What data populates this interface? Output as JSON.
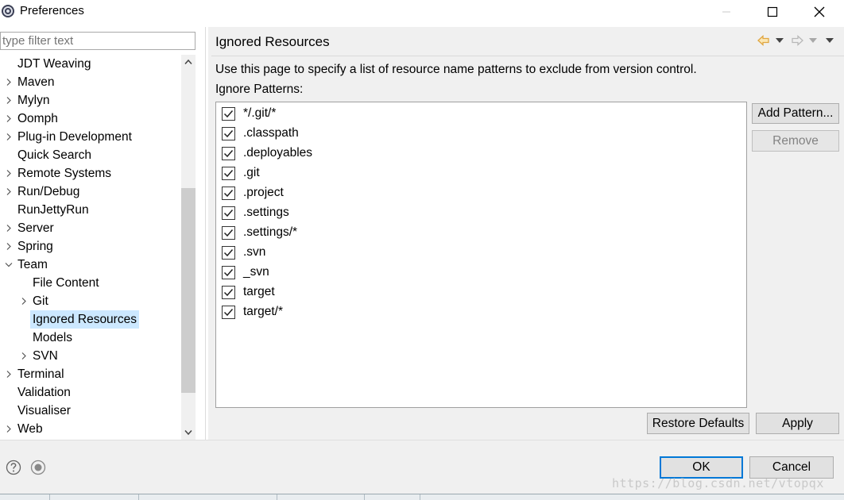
{
  "window": {
    "title": "Preferences"
  },
  "left": {
    "filter_placeholder": "type filter text",
    "tree": [
      {
        "label": "JDT Weaving",
        "twisty": ""
      },
      {
        "label": "Maven",
        "twisty": ">"
      },
      {
        "label": "Mylyn",
        "twisty": ">"
      },
      {
        "label": "Oomph",
        "twisty": ">"
      },
      {
        "label": "Plug-in Development",
        "twisty": ">"
      },
      {
        "label": "Quick Search",
        "twisty": ""
      },
      {
        "label": "Remote Systems",
        "twisty": ">"
      },
      {
        "label": "Run/Debug",
        "twisty": ">"
      },
      {
        "label": "RunJettyRun",
        "twisty": ""
      },
      {
        "label": "Server",
        "twisty": ">"
      },
      {
        "label": "Spring",
        "twisty": ">"
      },
      {
        "label": "Team",
        "twisty": "v"
      },
      {
        "label": "File Content",
        "twisty": "",
        "child": true
      },
      {
        "label": "Git",
        "twisty": ">",
        "child": true
      },
      {
        "label": "Ignored Resources",
        "twisty": "",
        "child": true,
        "selected": true
      },
      {
        "label": "Models",
        "twisty": "",
        "child": true
      },
      {
        "label": "SVN",
        "twisty": ">",
        "child": true
      },
      {
        "label": "Terminal",
        "twisty": ">"
      },
      {
        "label": "Validation",
        "twisty": ""
      },
      {
        "label": "Visualiser",
        "twisty": ""
      },
      {
        "label": "Web",
        "twisty": ">"
      }
    ]
  },
  "page": {
    "title": "Ignored Resources",
    "description": "Use this page to specify a list of resource name patterns to exclude from version control.",
    "patterns_label": "Ignore Patterns:",
    "patterns": [
      {
        "label": "*/.git/*",
        "checked": true
      },
      {
        "label": ".classpath",
        "checked": true
      },
      {
        "label": ".deployables",
        "checked": true
      },
      {
        "label": ".git",
        "checked": true
      },
      {
        "label": ".project",
        "checked": true
      },
      {
        "label": ".settings",
        "checked": true
      },
      {
        "label": ".settings/*",
        "checked": true
      },
      {
        "label": ".svn",
        "checked": true
      },
      {
        "label": "_svn",
        "checked": true
      },
      {
        "label": "target",
        "checked": true
      },
      {
        "label": "target/*",
        "checked": true
      }
    ],
    "add_pattern_label": "Add Pattern...",
    "remove_label": "Remove",
    "restore_defaults_label": "Restore Defaults",
    "apply_label": "Apply"
  },
  "footer": {
    "ok_label": "OK",
    "cancel_label": "Cancel",
    "watermark": "https://blog.csdn.net/vtopqx"
  },
  "colors": {
    "selection": "#cce8ff",
    "default_button_border": "#0078d7",
    "nav_back_arrow": "#e0a640"
  }
}
